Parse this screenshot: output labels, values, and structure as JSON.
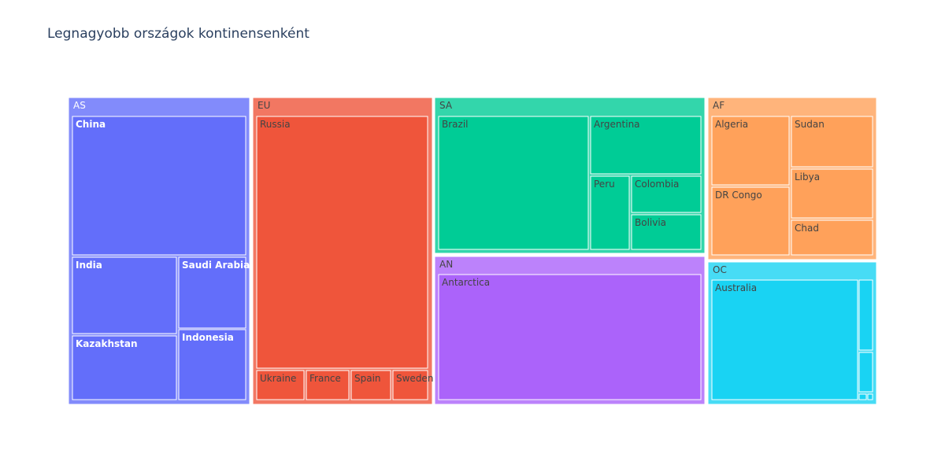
{
  "title": "Legnagyobb országok kontinensenként",
  "chart_data": {
    "type": "treemap",
    "title": "Legnagyobb országok kontinensenként",
    "groups": [
      {
        "name": "AS",
        "color": "#636efa",
        "label_color": "#ffffff",
        "bold": true,
        "children": [
          {
            "name": "China",
            "value": 9.6
          },
          {
            "name": "India",
            "value": 3.29
          },
          {
            "name": "Saudi Arabia",
            "value": 2.15
          },
          {
            "name": "Kazakhstan",
            "value": 2.72
          },
          {
            "name": "Indonesia",
            "value": 1.9
          }
        ]
      },
      {
        "name": "EU",
        "color": "#ef553b",
        "label_color": "#444444",
        "bold": false,
        "children": [
          {
            "name": "Russia",
            "value": 17.1
          },
          {
            "name": "Ukraine",
            "value": 0.6
          },
          {
            "name": "France",
            "value": 0.55
          },
          {
            "name": "Spain",
            "value": 0.51
          },
          {
            "name": "Sweden",
            "value": 0.45
          }
        ]
      },
      {
        "name": "SA",
        "color": "#00cc96",
        "label_color": "#444444",
        "bold": false,
        "children": [
          {
            "name": "Brazil",
            "value": 8.5
          },
          {
            "name": "Argentina",
            "value": 2.78
          },
          {
            "name": "Peru",
            "value": 1.29
          },
          {
            "name": "Colombia",
            "value": 1.14
          },
          {
            "name": "Bolivia",
            "value": 1.1
          }
        ]
      },
      {
        "name": "AN",
        "color": "#ab63fa",
        "label_color": "#444444",
        "bold": false,
        "children": [
          {
            "name": "Antarctica",
            "value": 14.0
          }
        ]
      },
      {
        "name": "AF",
        "color": "#ffa15a",
        "label_color": "#444444",
        "bold": false,
        "children": [
          {
            "name": "Algeria",
            "value": 2.38
          },
          {
            "name": "DR Congo",
            "value": 2.34
          },
          {
            "name": "Sudan",
            "value": 1.86
          },
          {
            "name": "Libya",
            "value": 1.76
          },
          {
            "name": "Chad",
            "value": 1.28
          }
        ]
      },
      {
        "name": "OC",
        "color": "#19d3f3",
        "label_color": "#444444",
        "bold": false,
        "children": [
          {
            "name": "Australia",
            "value": 7.69
          },
          {
            "name": "",
            "value": 0.46
          },
          {
            "name": "",
            "value": 0.27
          },
          {
            "name": "",
            "value": 0.02
          },
          {
            "name": "",
            "value": 0.01
          }
        ]
      }
    ]
  }
}
